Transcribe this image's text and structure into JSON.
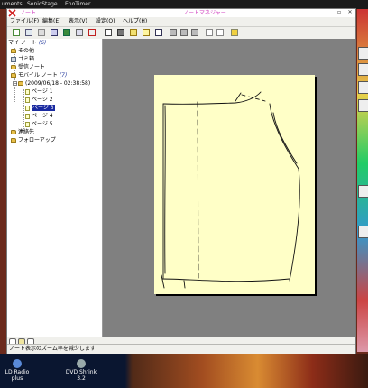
{
  "desktop": {
    "top_items": [
      "uments",
      "SonicStage",
      "EnoTimer"
    ],
    "bottom_icons": [
      {
        "line1": "LD Radio",
        "line2": "plus"
      },
      {
        "line1": "DVD Shrink",
        "line2": "3.2"
      }
    ]
  },
  "window": {
    "title_left": "ノート",
    "title": "ノートマネジャー"
  },
  "menu": [
    {
      "label": "ファイル(F)"
    },
    {
      "label": "編集(E)"
    },
    {
      "label": "表示(V)"
    },
    {
      "label": "設定(O)"
    },
    {
      "label": "ヘルプ(H)"
    }
  ],
  "tree": {
    "root": {
      "label": "マイ ノート",
      "count": "(6)"
    },
    "items": [
      {
        "label": "その他"
      },
      {
        "label": "ゴミ箱"
      },
      {
        "label": "受信ノート"
      },
      {
        "label": "モバイル ノート",
        "count": "(7)"
      },
      {
        "label": "(2009/06/18 - 02:38:58)"
      },
      {
        "label": "ページ 1"
      },
      {
        "label": "ページ 2"
      },
      {
        "label": "ページ 3"
      },
      {
        "label": "ページ 4"
      },
      {
        "label": "ページ 5"
      },
      {
        "label": "連絡先"
      },
      {
        "label": "フォローアップ"
      }
    ],
    "selected_index": 7
  },
  "statusbar": {
    "text": "ノート表示のズーム率を減少します"
  }
}
